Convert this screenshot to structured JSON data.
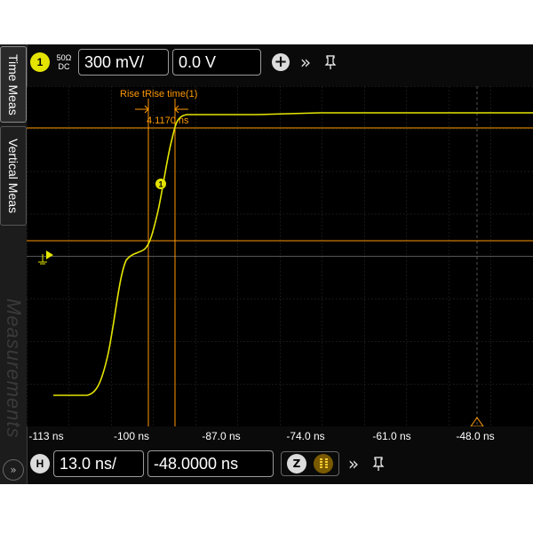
{
  "sidebar": {
    "tabs": [
      {
        "label": "Time Meas"
      },
      {
        "label": "Vertical Meas"
      },
      {
        "label": "Measurements"
      }
    ],
    "more_icon": "chevron-right-circle-icon",
    "more_label": "»"
  },
  "channel": {
    "badge": "1",
    "coupling_top": "50Ω",
    "coupling_bottom": "DC",
    "vertical_scale": "300 mV/",
    "offset": "0.0 V",
    "add_icon": "plus-circle-icon",
    "expand_icon": "double-chevron-right-icon",
    "pin_icon": "pin-icon",
    "color": "#e4e400"
  },
  "plot": {
    "trace_marker": "1",
    "measurement_label": "Rise tRise time(1)",
    "measurement_value": "4.1170 ns",
    "cursor_color": "#ff9900",
    "trace_color": "#e6e600",
    "ground_marker": "ground-icon"
  },
  "timebase": {
    "tick_labels": [
      "-113 ns",
      "-100 ns",
      "-87.0 ns",
      "-74.0 ns",
      "-61.0 ns",
      "-48.0 ns"
    ],
    "badge": "H",
    "scale": "13.0 ns/",
    "position": "-48.0000 ns",
    "zoom_label": "Z",
    "zoom_icon": "zoom-icon",
    "pause_icon": "pause-icon",
    "expand_icon": "double-chevron-right-icon",
    "pin_icon": "pin-icon",
    "trigger_marker_color": "#ff9900"
  }
}
